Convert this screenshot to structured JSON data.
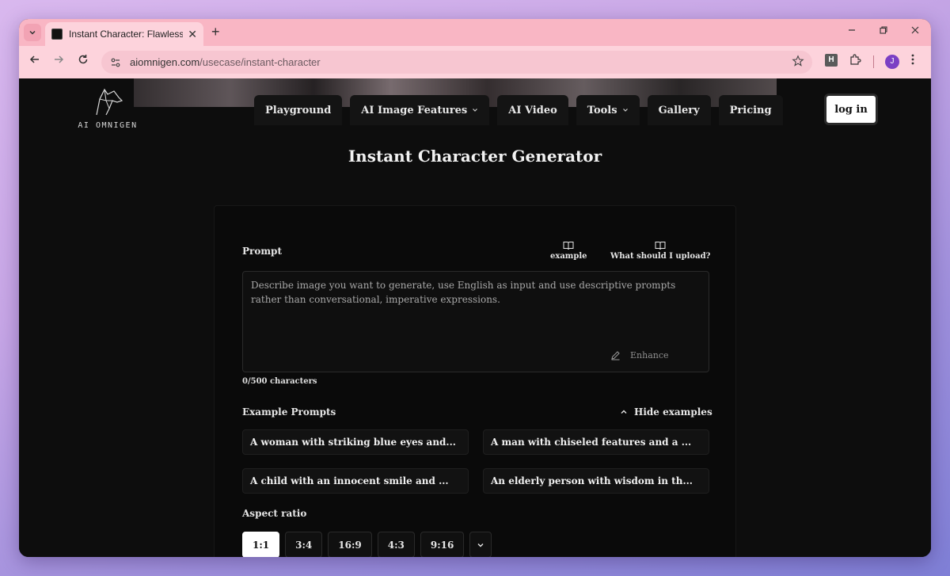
{
  "browser": {
    "tab_title": "Instant Character: Flawless AI Ch",
    "new_tab_symbol": "+",
    "close_symbol": "✕",
    "url_domain": "aiomnigen.com",
    "url_path": "/usecase/instant-character",
    "extension_h_label": "H",
    "profile_initial": "J"
  },
  "site": {
    "logo_text": "AI OMNIGEN",
    "nav": [
      {
        "label": "Playground",
        "has_menu": false
      },
      {
        "label": "AI Image Features",
        "has_menu": true
      },
      {
        "label": "AI Video",
        "has_menu": false
      },
      {
        "label": "Tools",
        "has_menu": true
      },
      {
        "label": "Gallery",
        "has_menu": false
      },
      {
        "label": "Pricing",
        "has_menu": false
      }
    ],
    "login_label": "log in"
  },
  "main": {
    "title": "Instant Character Generator",
    "prompt_label": "Prompt",
    "helpers": {
      "example_label": "example",
      "upload_help_label": "What should I upload?"
    },
    "prompt_placeholder": "Describe image you want to generate, use English as input and use descriptive prompts rather than conversational, imperative expressions.",
    "prompt_value": "",
    "enhance_label": "Enhance",
    "char_count": "0/500 characters",
    "examples_label": "Example Prompts",
    "hide_examples_label": "Hide examples",
    "example_prompts": [
      "A woman with striking blue eyes and...",
      "A man with chiseled features and a ...",
      "A child with an innocent smile and ...",
      "An elderly person with wisdom in th..."
    ],
    "aspect_label": "Aspect ratio",
    "aspect_ratios": [
      "1:1",
      "3:4",
      "16:9",
      "4:3",
      "9:16"
    ],
    "aspect_selected": "1:1"
  }
}
